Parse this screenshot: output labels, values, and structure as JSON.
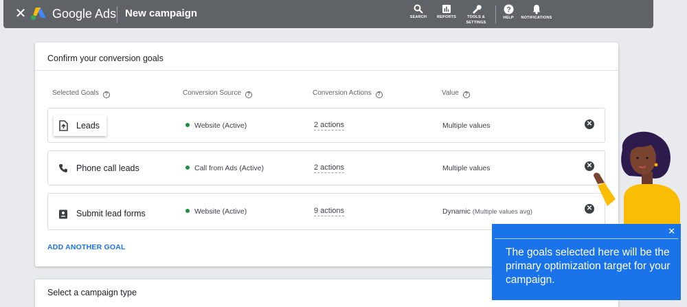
{
  "header": {
    "app_name": "Google Ads",
    "page_title": "New campaign",
    "tools": [
      {
        "label": "SEARCH",
        "icon": "search-icon"
      },
      {
        "label": "REPORTS",
        "icon": "reports-icon"
      },
      {
        "label_line1": "TOOLS &",
        "label_line2": "SETTINGS",
        "icon": "wrench-icon"
      },
      {
        "label": "HELP",
        "icon": "help-icon"
      },
      {
        "label": "NOTIFICATIONS",
        "icon": "bell-icon"
      }
    ]
  },
  "goals_card": {
    "heading": "Confirm your conversion goals",
    "columns": [
      "Selected Goals",
      "Conversion Source",
      "Conversion Actions",
      "Value"
    ],
    "rows": [
      {
        "name": "Leads",
        "icon": "upload-document-icon",
        "source": "Website (Active)",
        "actions": "2 actions",
        "value": "Multiple values",
        "value_sub": ""
      },
      {
        "name": "Phone call leads",
        "icon": "phone-icon",
        "source": "Call from Ads (Active)",
        "actions": "2 actions",
        "value": "Multiple values",
        "value_sub": ""
      },
      {
        "name": "Submit lead forms",
        "icon": "contact-form-icon",
        "source": "Website (Active)",
        "actions": "9 actions",
        "value": "Dynamic",
        "value_sub": "(Multiple values avg)"
      }
    ],
    "add_goal": "ADD ANOTHER GOAL"
  },
  "type_card": {
    "heading": "Select a campaign type"
  },
  "callout": {
    "text": "The goals selected here will be the primary optimization target for your campaign.",
    "close": "✕"
  },
  "colors": {
    "topbar": "#5f6368",
    "accent": "#1a73e8",
    "active_dot": "#1e8e3e"
  }
}
